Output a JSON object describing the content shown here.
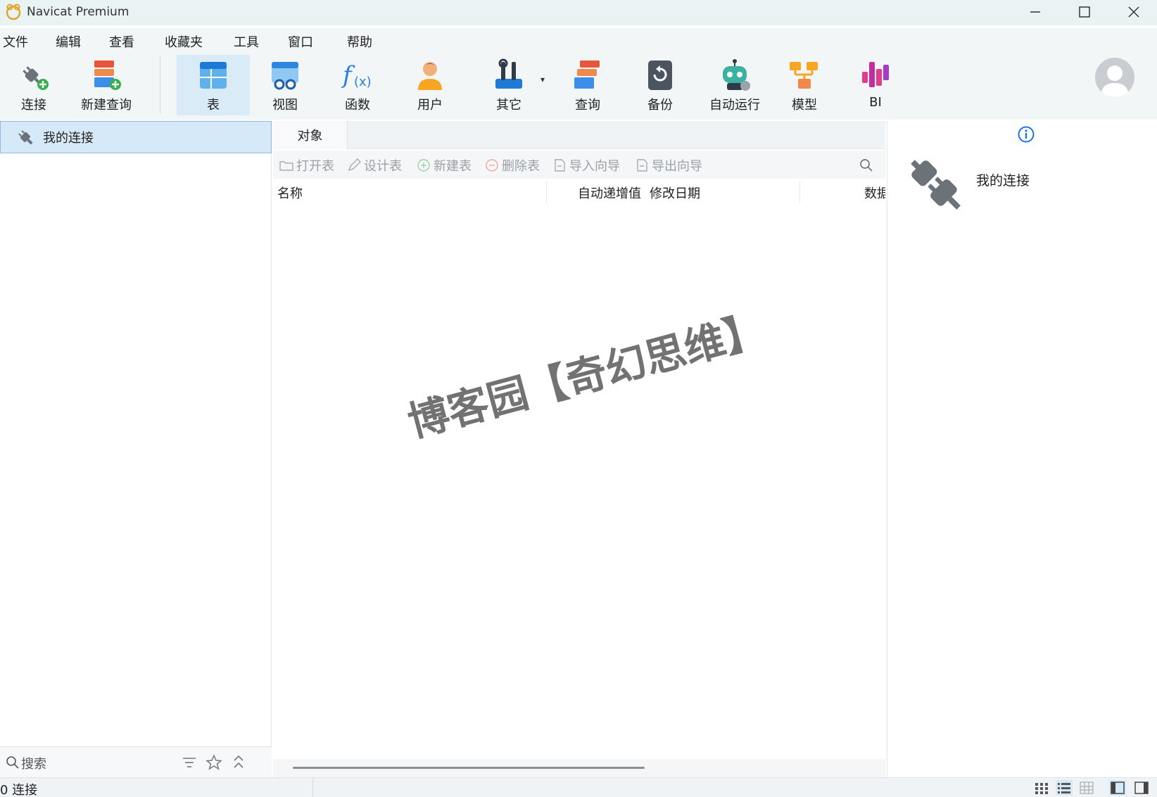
{
  "window": {
    "title": "Navicat Premium"
  },
  "menu": [
    "文件",
    "编辑",
    "查看",
    "收藏夹",
    "工具",
    "窗口",
    "帮助"
  ],
  "toolbar": {
    "connect": "连接",
    "new_query": "新建查询",
    "table": "表",
    "view": "视图",
    "function": "函数",
    "user": "用户",
    "other": "其它",
    "query": "查询",
    "backup": "备份",
    "automation": "自动运行",
    "model": "模型",
    "bi": "BI"
  },
  "left": {
    "connection_label": "我的连接",
    "search_placeholder": "搜索"
  },
  "center": {
    "tab": "对象",
    "actions": [
      "打开表",
      "设计表",
      "新建表",
      "删除表",
      "导入向导",
      "导出向导"
    ],
    "columns": [
      "名称",
      "自动递增值",
      "修改日期",
      "数据"
    ]
  },
  "right": {
    "connection_name": "我的连接"
  },
  "status": {
    "text": "0 连接"
  },
  "watermark": "博客园【奇幻思维】",
  "colors": {
    "accent": "#1a73e8",
    "selection": "#d6e9f8"
  }
}
